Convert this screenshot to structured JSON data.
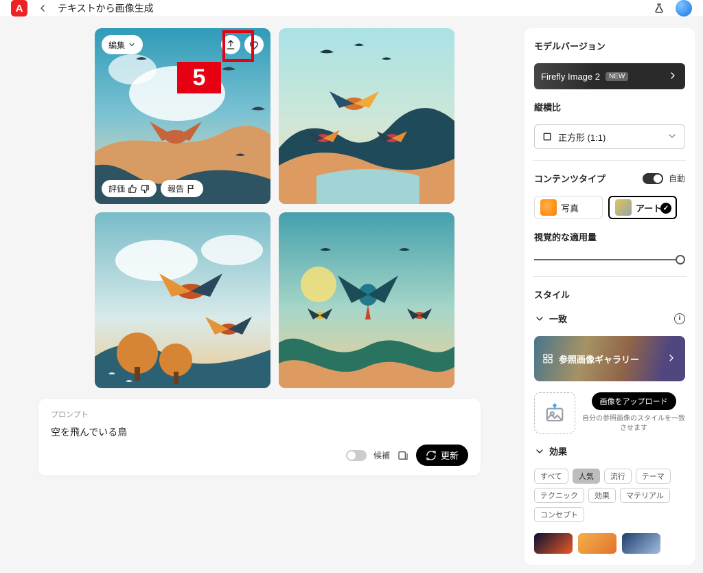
{
  "header": {
    "title": "テキストから画像生成"
  },
  "overlay": {
    "edit_label": "編集",
    "rate_label": "評価",
    "report_label": "報告"
  },
  "callout": {
    "num": "5"
  },
  "prompt": {
    "label": "プロンプト",
    "text": "空を飛んでいる鳥",
    "candidates_label": "候補",
    "update_label": "更新"
  },
  "panel": {
    "model_title": "モデルバージョン",
    "model_name": "Firefly Image 2",
    "model_badge": "NEW",
    "aspect_title": "縦横比",
    "aspect_value": "正方形 (1:1)",
    "content_title": "コンテンツタイプ",
    "auto_label": "自動",
    "content_photo": "写真",
    "content_art": "アート",
    "strength_title": "視覚的な適用量",
    "style_title": "スタイル",
    "match_title": "一致",
    "gallery_label": "参照画像ギャラリー",
    "upload_label": "画像をアップロード",
    "upload_hint": "自分の参照画像のスタイルを一致させます",
    "effect_title": "効果",
    "tags": [
      "すべて",
      "人気",
      "流行",
      "テーマ",
      "テクニック",
      "効果",
      "マテリアル",
      "コンセプト"
    ],
    "tag_selected_index": 1
  }
}
